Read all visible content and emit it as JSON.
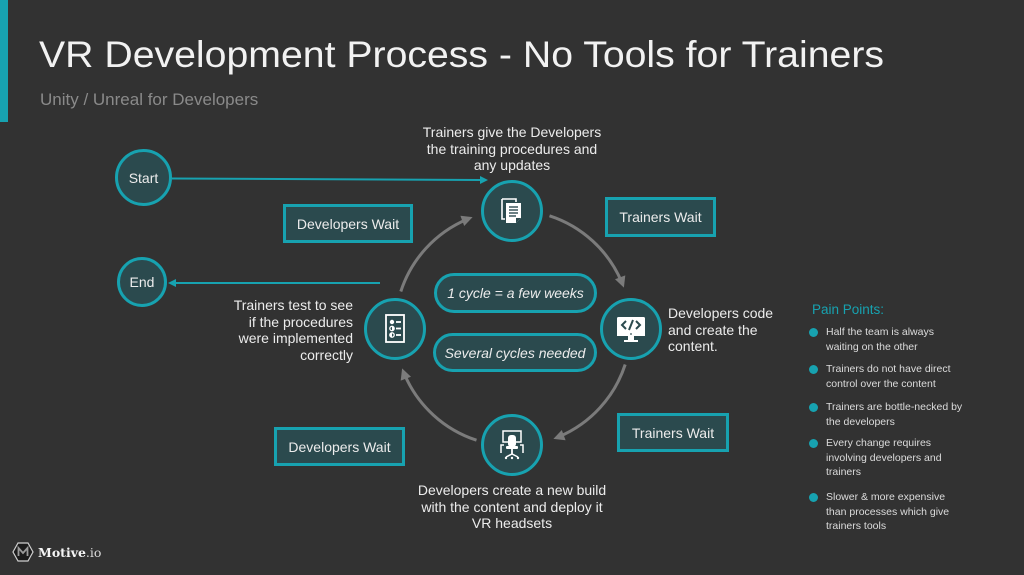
{
  "colors": {
    "background": "#323232",
    "accent": "#17a2b0",
    "node_fill": "#2b4a4e",
    "cycle_arrow": "#7b7b7b",
    "text": "#ececec",
    "muted_text": "#8a8a8a"
  },
  "slide": {
    "title": "VR Development Process - No Tools for Trainers",
    "subtitle": "Unity / Unreal for Developers"
  },
  "flow": {
    "start_label": "Start",
    "end_label": "End",
    "steps": [
      {
        "icon": "document-icon",
        "lines": [
          "Trainers give the Developers",
          "the training procedures and",
          "any updates"
        ]
      },
      {
        "icon": "code-monitor-icon",
        "lines": [
          "Developers code",
          "and create the",
          "content."
        ]
      },
      {
        "icon": "workstation-icon",
        "lines": [
          "Developers create a new build",
          "with the content and deploy it",
          "VR headsets"
        ]
      },
      {
        "icon": "checklist-icon",
        "lines": [
          "Trainers test to see",
          "if the procedures",
          "were implemented",
          "correctly"
        ]
      }
    ],
    "wait_boxes": [
      "Developers Wait",
      "Trainers Wait",
      "Developers Wait",
      "Trainers Wait"
    ],
    "cycle_notes": [
      "1 cycle = a few weeks",
      "Several cycles needed"
    ]
  },
  "pain_points": {
    "title": "Pain Points:",
    "items": [
      {
        "lines": [
          "Half the team is always",
          "waiting on the other"
        ]
      },
      {
        "lines": [
          "Trainers do not have direct",
          "control over the content"
        ]
      },
      {
        "lines": [
          "Trainers are bottle-necked by",
          "the developers"
        ]
      },
      {
        "lines": [
          "Every change requires",
          "involving developers and",
          "trainers"
        ]
      },
      {
        "lines": [
          "Slower & more expensive",
          "than processes which give",
          "trainers tools"
        ]
      }
    ]
  },
  "brand": {
    "name_bold": "Motive",
    "name_suffix": ".io"
  }
}
